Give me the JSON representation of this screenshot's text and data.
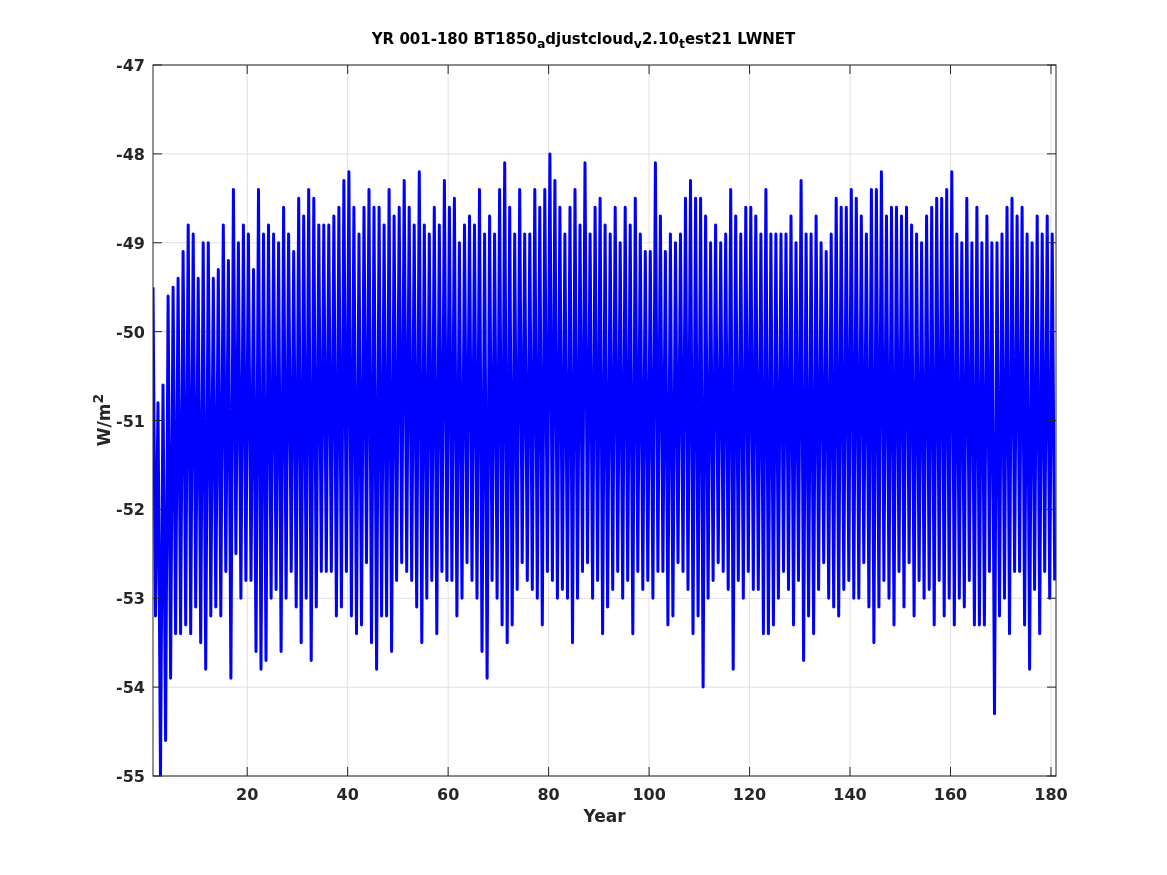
{
  "figure": {
    "chart_data": {
      "type": "line",
      "title": "YR 001-180 BT1850$_{a}$djustcloud$_{v}$2.10$_{t}$est21 LWNET",
      "xlabel": "Year",
      "ylabel": "W/m$^{2}$",
      "xlim": [
        1.25,
        181
      ],
      "ylim": [
        -55,
        -47
      ],
      "grid": true,
      "xticks": [
        {
          "value": 20,
          "label": "20"
        },
        {
          "value": 40,
          "label": "40"
        },
        {
          "value": 60,
          "label": "60"
        },
        {
          "value": 80,
          "label": "80"
        },
        {
          "value": 100,
          "label": "100"
        },
        {
          "value": 120,
          "label": "120"
        },
        {
          "value": 140,
          "label": "140"
        },
        {
          "value": 160,
          "label": "160"
        },
        {
          "value": 180,
          "label": "180"
        }
      ],
      "yticks": [
        -55,
        -54,
        -53,
        -52,
        -51,
        -50,
        -49,
        -48,
        -47
      ],
      "x": [
        1.25,
        1.75,
        2.25,
        2.75,
        3.25,
        3.75,
        4.25,
        4.75,
        5.25,
        5.75,
        6.25,
        6.75,
        7.25,
        7.75,
        8.25,
        8.75,
        9.25,
        9.75,
        10.25,
        10.75,
        11.25,
        11.75,
        12.25,
        12.75,
        13.25,
        13.75,
        14.25,
        14.75,
        15.25,
        15.75,
        16.25,
        16.75,
        17.25,
        17.75,
        18.25,
        18.75,
        19.25,
        19.75,
        20.25,
        20.75,
        21.25,
        21.75,
        22.25,
        22.75,
        23.25,
        23.75,
        24.25,
        24.75,
        25.25,
        25.75,
        26.25,
        26.75,
        27.25,
        27.75,
        28.25,
        28.75,
        29.25,
        29.75,
        30.25,
        30.75,
        31.25,
        31.75,
        32.25,
        32.75,
        33.25,
        33.75,
        34.25,
        34.75,
        35.25,
        35.75,
        36.25,
        36.75,
        37.25,
        37.75,
        38.25,
        38.75,
        39.25,
        39.75,
        40.25,
        40.75,
        41.25,
        41.75,
        42.25,
        42.75,
        43.25,
        43.75,
        44.25,
        44.75,
        45.25,
        45.75,
        46.25,
        46.75,
        47.25,
        47.75,
        48.25,
        48.75,
        49.25,
        49.75,
        50.25,
        50.75,
        51.25,
        51.75,
        52.25,
        52.75,
        53.25,
        53.75,
        54.25,
        54.75,
        55.25,
        55.75,
        56.25,
        56.75,
        57.25,
        57.75,
        58.25,
        58.75,
        59.25,
        59.75,
        60.25,
        60.75,
        61.25,
        61.75,
        62.25,
        62.75,
        63.25,
        63.75,
        64.25,
        64.75,
        65.25,
        65.75,
        66.25,
        66.75,
        67.25,
        67.75,
        68.25,
        68.75,
        69.25,
        69.75,
        70.25,
        70.75,
        71.25,
        71.75,
        72.25,
        72.75,
        73.25,
        73.75,
        74.25,
        74.75,
        75.25,
        75.75,
        76.25,
        76.75,
        77.25,
        77.75,
        78.25,
        78.75,
        79.25,
        79.75,
        80.25,
        80.75,
        81.25,
        81.75,
        82.25,
        82.75,
        83.25,
        83.75,
        84.25,
        84.75,
        85.25,
        85.75,
        86.25,
        86.75,
        87.25,
        87.75,
        88.25,
        88.75,
        89.25,
        89.75,
        90.25,
        90.75,
        91.25,
        91.75,
        92.25,
        92.75,
        93.25,
        93.75,
        94.25,
        94.75,
        95.25,
        95.75,
        96.25,
        96.75,
        97.25,
        97.75,
        98.25,
        98.75,
        99.25,
        99.75,
        100.25,
        100.75,
        101.25,
        101.75,
        102.25,
        102.75,
        103.25,
        103.75,
        104.25,
        104.75,
        105.25,
        105.75,
        106.25,
        106.75,
        107.25,
        107.75,
        108.25,
        108.75,
        109.25,
        109.75,
        110.25,
        110.75,
        111.25,
        111.75,
        112.25,
        112.75,
        113.25,
        113.75,
        114.25,
        114.75,
        115.25,
        115.75,
        116.25,
        116.75,
        117.25,
        117.75,
        118.25,
        118.75,
        119.25,
        119.75,
        120.25,
        120.75,
        121.25,
        121.75,
        122.25,
        122.75,
        123.25,
        123.75,
        124.25,
        124.75,
        125.25,
        125.75,
        126.25,
        126.75,
        127.25,
        127.75,
        128.25,
        128.75,
        129.25,
        129.75,
        130.25,
        130.75,
        131.25,
        131.75,
        132.25,
        132.75,
        133.25,
        133.75,
        134.25,
        134.75,
        135.25,
        135.75,
        136.25,
        136.75,
        137.25,
        137.75,
        138.25,
        138.75,
        139.25,
        139.75,
        140.25,
        140.75,
        141.25,
        141.75,
        142.25,
        142.75,
        143.25,
        143.75,
        144.25,
        144.75,
        145.25,
        145.75,
        146.25,
        146.75,
        147.25,
        147.75,
        148.25,
        148.75,
        149.25,
        149.75,
        150.25,
        150.75,
        151.25,
        151.75,
        152.25,
        152.75,
        153.25,
        153.75,
        154.25,
        154.75,
        155.25,
        155.75,
        156.25,
        156.75,
        157.25,
        157.75,
        158.25,
        158.75,
        159.25,
        159.75,
        160.25,
        160.75,
        161.25,
        161.75,
        162.25,
        162.75,
        163.25,
        163.75,
        164.25,
        164.75,
        165.25,
        165.75,
        166.25,
        166.75,
        167.25,
        167.75,
        168.25,
        168.75,
        169.25,
        169.75,
        170.25,
        170.75,
        171.25,
        171.75,
        172.25,
        172.75,
        173.25,
        173.75,
        174.25,
        174.75,
        175.25,
        175.75,
        176.25,
        176.75,
        177.25,
        177.75,
        178.25,
        178.75,
        179.25,
        179.75,
        180.25,
        180.75
      ],
      "series": [
        {
          "color": "#0000ff",
          "values": [
            -49.5,
            -53.2,
            -50.8,
            -55.0,
            -50.6,
            -54.6,
            -49.6,
            -53.9,
            -49.5,
            -53.4,
            -49.4,
            -53.4,
            -49.1,
            -53.3,
            -48.8,
            -53.4,
            -48.9,
            -53.1,
            -49.4,
            -53.5,
            -49.0,
            -53.8,
            -49.0,
            -53.2,
            -49.4,
            -53.1,
            -49.3,
            -53.2,
            -48.8,
            -52.7,
            -49.2,
            -53.9,
            -48.4,
            -52.5,
            -49.0,
            -53.0,
            -48.8,
            -52.8,
            -48.9,
            -52.8,
            -49.3,
            -53.6,
            -48.4,
            -53.8,
            -48.9,
            -53.7,
            -48.8,
            -53.0,
            -48.9,
            -52.9,
            -49.0,
            -53.6,
            -48.6,
            -53.0,
            -48.9,
            -52.7,
            -49.1,
            -53.1,
            -48.5,
            -53.5,
            -48.7,
            -53.0,
            -48.4,
            -53.7,
            -48.5,
            -53.1,
            -48.8,
            -52.7,
            -48.8,
            -52.7,
            -48.8,
            -52.7,
            -48.7,
            -53.2,
            -48.6,
            -53.1,
            -48.3,
            -52.7,
            -48.2,
            -53.2,
            -48.6,
            -53.4,
            -48.9,
            -53.3,
            -48.6,
            -52.6,
            -48.4,
            -53.5,
            -48.6,
            -53.8,
            -48.6,
            -53.2,
            -48.8,
            -53.2,
            -48.4,
            -53.6,
            -48.7,
            -52.8,
            -48.6,
            -52.6,
            -48.3,
            -52.7,
            -48.6,
            -52.8,
            -48.8,
            -53.1,
            -48.2,
            -53.5,
            -48.8,
            -53.0,
            -48.9,
            -52.8,
            -48.6,
            -53.4,
            -48.8,
            -52.7,
            -48.3,
            -52.8,
            -48.6,
            -52.8,
            -48.5,
            -53.2,
            -49.0,
            -53.0,
            -48.8,
            -52.6,
            -48.7,
            -52.8,
            -48.8,
            -53.0,
            -48.4,
            -53.6,
            -48.9,
            -53.9,
            -48.7,
            -52.8,
            -48.9,
            -53.0,
            -48.4,
            -53.3,
            -48.1,
            -53.5,
            -48.6,
            -53.3,
            -48.9,
            -52.9,
            -48.4,
            -52.6,
            -48.9,
            -52.8,
            -48.9,
            -52.9,
            -48.4,
            -53.0,
            -48.6,
            -53.3,
            -48.4,
            -52.7,
            -48.0,
            -52.8,
            -48.3,
            -53.0,
            -48.6,
            -52.9,
            -48.9,
            -53.0,
            -48.6,
            -53.5,
            -48.4,
            -53.0,
            -48.8,
            -52.7,
            -48.1,
            -52.6,
            -48.9,
            -53.0,
            -48.6,
            -52.8,
            -48.5,
            -53.4,
            -48.8,
            -53.1,
            -48.9,
            -52.9,
            -48.6,
            -52.7,
            -49.0,
            -53.0,
            -48.6,
            -52.8,
            -48.8,
            -53.4,
            -48.5,
            -52.7,
            -48.9,
            -52.9,
            -49.1,
            -52.8,
            -49.1,
            -53.0,
            -48.1,
            -52.7,
            -48.7,
            -52.7,
            -49.1,
            -53.3,
            -48.9,
            -53.2,
            -49.0,
            -52.6,
            -48.9,
            -52.7,
            -48.5,
            -52.9,
            -48.3,
            -53.4,
            -48.5,
            -53.2,
            -48.5,
            -54.0,
            -48.7,
            -53.0,
            -49.0,
            -52.8,
            -48.8,
            -52.6,
            -49.0,
            -52.7,
            -48.9,
            -52.9,
            -48.4,
            -53.8,
            -48.7,
            -52.8,
            -48.9,
            -53.0,
            -48.6,
            -52.7,
            -48.6,
            -52.9,
            -48.7,
            -52.9,
            -48.9,
            -53.4,
            -48.4,
            -53.4,
            -48.9,
            -53.3,
            -48.9,
            -53.0,
            -48.9,
            -52.7,
            -48.9,
            -52.9,
            -48.7,
            -53.3,
            -49.0,
            -52.8,
            -48.3,
            -53.7,
            -48.9,
            -53.2,
            -48.9,
            -53.4,
            -48.7,
            -52.9,
            -49.0,
            -52.6,
            -49.1,
            -53.0,
            -48.9,
            -53.1,
            -48.5,
            -53.2,
            -48.6,
            -52.9,
            -48.6,
            -52.8,
            -48.4,
            -53.0,
            -48.5,
            -53.0,
            -48.7,
            -52.6,
            -48.9,
            -53.1,
            -48.4,
            -53.5,
            -48.4,
            -53.1,
            -48.2,
            -52.8,
            -48.7,
            -53.0,
            -48.6,
            -53.3,
            -48.6,
            -52.7,
            -48.7,
            -53.1,
            -48.6,
            -52.6,
            -48.8,
            -53.2,
            -48.9,
            -52.8,
            -49.0,
            -53.0,
            -48.7,
            -52.9,
            -48.6,
            -53.3,
            -48.5,
            -52.8,
            -48.5,
            -53.2,
            -48.4,
            -53.0,
            -48.2,
            -53.3,
            -48.9,
            -53.0,
            -49.0,
            -53.1,
            -48.5,
            -52.8,
            -49.0,
            -53.3,
            -48.6,
            -53.3,
            -49.0,
            -53.3,
            -48.7,
            -52.7,
            -49.0,
            -54.3,
            -49.0,
            -53.2,
            -48.9,
            -53.0,
            -48.6,
            -53.4,
            -48.5,
            -52.7,
            -48.7,
            -52.7,
            -48.6,
            -53.3,
            -48.9,
            -53.8,
            -49.0,
            -52.9,
            -48.7,
            -53.4,
            -48.9,
            -52.7,
            -48.7,
            -53.0,
            -48.9,
            -52.8
          ]
        }
      ]
    }
  }
}
